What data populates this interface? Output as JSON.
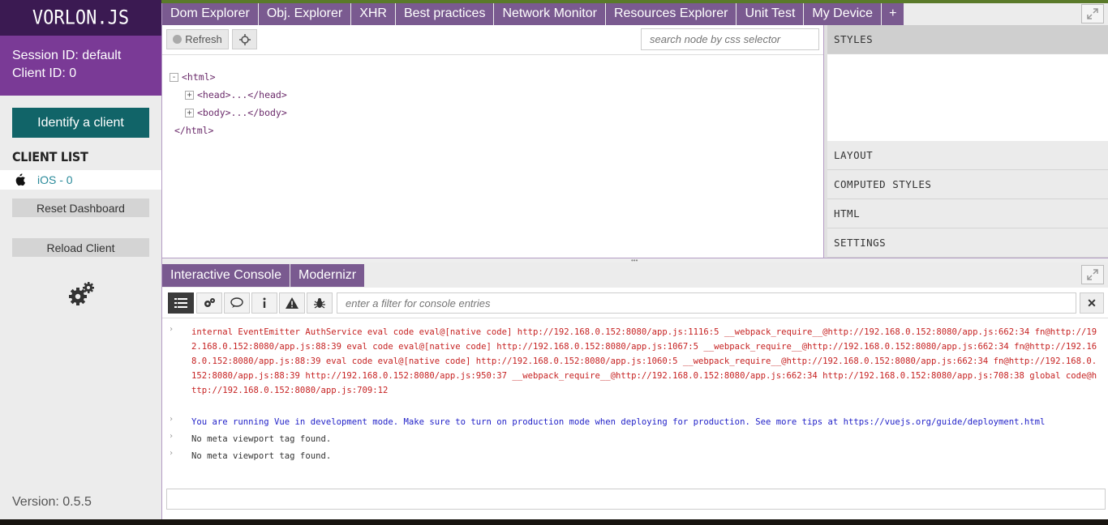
{
  "app": {
    "logo": "VORLON.JS",
    "version": "Version: 0.5.5"
  },
  "session": {
    "session_label": "Session ID:",
    "session_value": "default",
    "client_label": "Client ID:",
    "client_value": "0"
  },
  "sidebar": {
    "identify_label": "Identify a client",
    "client_list_title": "CLIENT LIST",
    "clients": [
      {
        "icon": "apple-icon",
        "label": "iOS - 0"
      }
    ],
    "reset_label": "Reset Dashboard",
    "reload_label": "Reload Client"
  },
  "top_tabs": [
    "Dom Explorer",
    "Obj. Explorer",
    "XHR",
    "Best practices",
    "Network Monitor",
    "Resources Explorer",
    "Unit Test",
    "My Device",
    "+"
  ],
  "dom_explorer": {
    "refresh_label": "Refresh",
    "search_placeholder": "search node by css selector",
    "tree": {
      "html_open": "<html>",
      "head": "<head>...</head>",
      "body": "<body>...</body>",
      "html_close": "</html>",
      "expanded_symbol": "-",
      "collapsed_symbol": "+"
    }
  },
  "right_panel": {
    "sections": [
      "STYLES",
      "LAYOUT",
      "COMPUTED STYLES",
      "HTML",
      "SETTINGS"
    ],
    "active": "STYLES"
  },
  "console_tabs": [
    "Interactive Console",
    "Modernizr"
  ],
  "console": {
    "filter_placeholder": "enter a filter for console entries",
    "clear_label": "✕",
    "entries": [
      {
        "level": "error",
        "text": "internal EventEmitter AuthService eval code eval@[native code] http://192.168.0.152:8080/app.js:1116:5 __webpack_require__@http://192.168.0.152:8080/app.js:662:34 fn@http://192.168.0.152:8080/app.js:88:39 eval code eval@[native code] http://192.168.0.152:8080/app.js:1067:5 __webpack_require__@http://192.168.0.152:8080/app.js:662:34 fn@http://192.168.0.152:8080/app.js:88:39 eval code eval@[native code] http://192.168.0.152:8080/app.js:1060:5 __webpack_require__@http://192.168.0.152:8080/app.js:662:34 fn@http://192.168.0.152:8080/app.js:88:39 http://192.168.0.152:8080/app.js:950:37 __webpack_require__@http://192.168.0.152:8080/app.js:662:34 http://192.168.0.152:8080/app.js:708:38 global code@http://192.168.0.152:8080/app.js:709:12"
      },
      {
        "level": "info",
        "text": "You are running Vue in development mode. Make sure to turn on production mode when deploying for production. See more tips at https://vuejs.org/guide/deployment.html"
      },
      {
        "level": "log",
        "text": "No meta viewport tag found."
      },
      {
        "level": "log",
        "text": "No meta viewport tag found."
      }
    ]
  },
  "colors": {
    "logo_bg": "#3b1a52",
    "session_bg": "#7a3a96",
    "tab_bg": "#7a5a90",
    "identify_bg": "#116468",
    "error": "#c62222",
    "info": "#2222c8"
  }
}
